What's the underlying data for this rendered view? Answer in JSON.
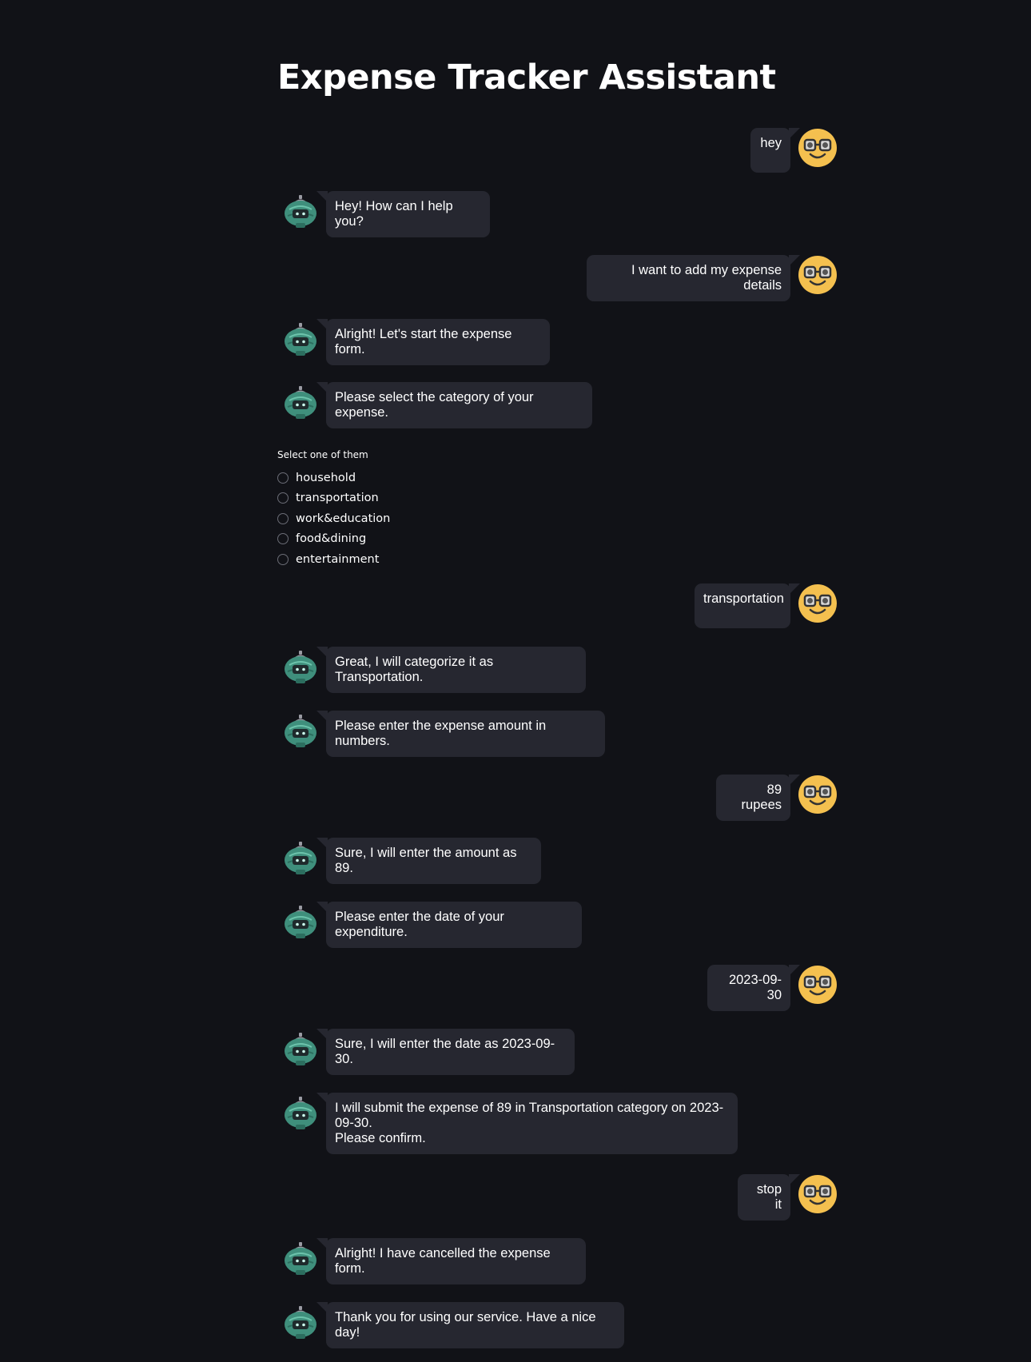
{
  "app": {
    "title": "Expense Tracker Assistant"
  },
  "chat": {
    "messages": [
      {
        "role": "user",
        "text": "hey"
      },
      {
        "role": "assistant",
        "text": "Hey! How can I help you?"
      },
      {
        "role": "user",
        "text": "I want to add my expense details"
      },
      {
        "role": "assistant",
        "text": "Alright! Let's start the expense form."
      },
      {
        "role": "assistant",
        "text": "Please select the category of your expense."
      },
      {
        "role": "user",
        "text": "transportation"
      },
      {
        "role": "assistant",
        "text": "Great, I will categorize it as Transportation."
      },
      {
        "role": "assistant",
        "text": "Please enter the expense amount in numbers."
      },
      {
        "role": "user",
        "text": "89 rupees"
      },
      {
        "role": "assistant",
        "text": "Sure, I will enter the amount as 89."
      },
      {
        "role": "assistant",
        "text": "Please enter the date of your expenditure."
      },
      {
        "role": "user",
        "text": "2023-09-30"
      },
      {
        "role": "assistant",
        "text": "Sure, I will enter the date as 2023-09-30."
      },
      {
        "role": "assistant",
        "text": "I will submit the expense of 89 in Transportation category on 2023-\n09-30.\nPlease confirm."
      },
      {
        "role": "user",
        "text": "stop it"
      },
      {
        "role": "assistant",
        "text": "Alright! I have cancelled the expense form."
      },
      {
        "role": "assistant",
        "text": "Thank you for using our service. Have a nice day!"
      }
    ]
  },
  "category_picker": {
    "label": "Select one of them",
    "options": [
      "household",
      "transportation",
      "work&education",
      "food&dining",
      "entertainment"
    ],
    "selected": null
  },
  "avatars": {
    "user": "nerd-face-emoji-icon",
    "assistant": "robot-icon"
  },
  "colors": {
    "background": "#111217",
    "bubble": "#262730",
    "text": "#ffffff",
    "user_avatar": "#f4c04f",
    "assistant_avatar": "#3f8f7c"
  }
}
